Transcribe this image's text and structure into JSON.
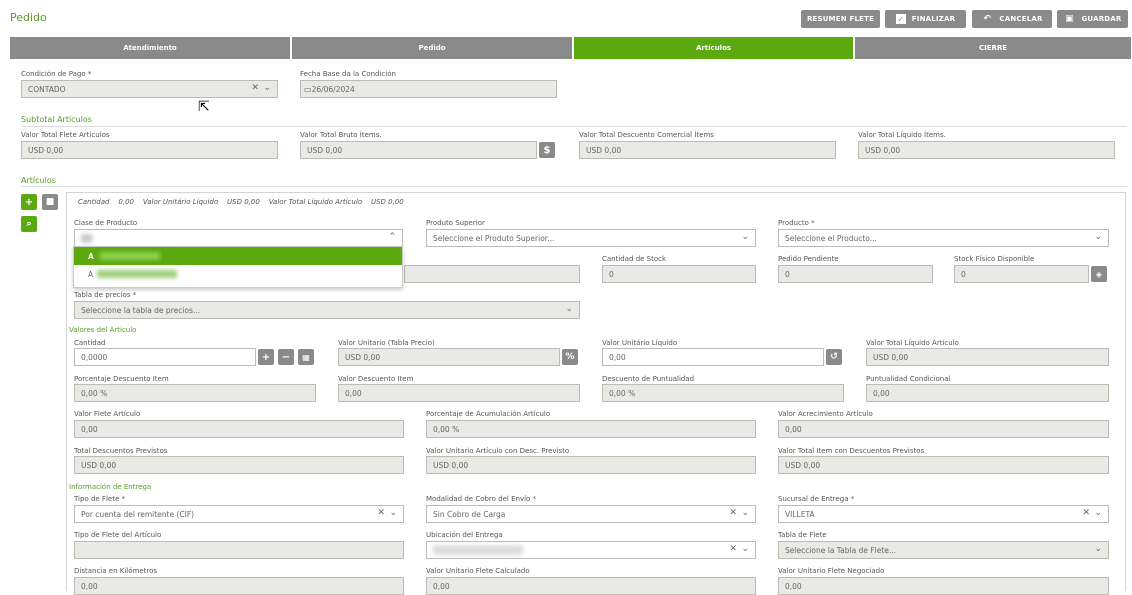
{
  "page": {
    "title": "Pedido"
  },
  "toolbar": {
    "resumen": "RESUMEN FLETE",
    "finalizar": "FINALIZAR",
    "cancelar": "CANCELAR",
    "guardar": "GUARDAR"
  },
  "tabs": [
    "Atendimiento",
    "Pedido",
    "Artículos",
    "CIERRE"
  ],
  "cond": {
    "label": "Condición de Pago *",
    "value": "CONTADO"
  },
  "fecha": {
    "label": "Fecha Base da la Condición",
    "value": "26/06/2024"
  },
  "subtotal": {
    "heading": "Subtotal Artículos",
    "flete": {
      "label": "Valor Total Flete Artículos",
      "value": "USD 0,00"
    },
    "bruto": {
      "label": "Valor Total Bruto Ítems.",
      "value": "USD 0,00"
    },
    "descuento": {
      "label": "Valor Total Descuento Comercial Ítems",
      "value": "USD 0,00"
    },
    "liquido": {
      "label": "Valor Total Líquido Ítems.",
      "value": "USD 0,00"
    }
  },
  "articulos": {
    "heading": "Artículos"
  },
  "summary": {
    "cantidad_label": "Cantidad",
    "cantidad": "0,00",
    "vul_label": "Valor Unitário Líquido",
    "vul": "USD 0,00",
    "vtl_label": "Valor Total Líquido Artículo",
    "vtl": "USD 0,00"
  },
  "clase": {
    "label": "Clase de Producto",
    "dropdown": [
      "A",
      "A"
    ]
  },
  "superior": {
    "label": "Produto Superior",
    "placeholder": "Seleccione el Produto Superior..."
  },
  "producto": {
    "label": "Producto *",
    "placeholder": "Seleccione el Producto..."
  },
  "stock": {
    "label": "Cantidad de Stock",
    "value": "0"
  },
  "pendiente": {
    "label": "Pedido Pendiente",
    "value": "0"
  },
  "fisico": {
    "label": "Stock Físico Disponible",
    "value": "0"
  },
  "tabla": {
    "label": "Tabla de precios *",
    "placeholder": "Seleccione la tabla de precios..."
  },
  "valores": {
    "heading": "Valores del Artículo",
    "cantidad": {
      "label": "Cantidad",
      "value": "0,0000"
    },
    "vutp": {
      "label": "Valor Unitario (Tabla Precio)",
      "value": "USD 0,00"
    },
    "vul": {
      "label": "Valor Unitário Líquido",
      "value": "0,00"
    },
    "vtla": {
      "label": "Valor Total Líquido Artículo",
      "value": "USD 0,00"
    },
    "pdi": {
      "label": "Porcentaje Descuento Item",
      "value": "0,00 %"
    },
    "vdi": {
      "label": "Valor Descuento Item",
      "value": "0,00"
    },
    "dp": {
      "label": "Descuento de Puntualidad",
      "value": "0,00 %"
    },
    "pc": {
      "label": "Puntualidad Condicional",
      "value": "0,00"
    },
    "vfa": {
      "label": "Valor Flete Artículo",
      "value": "0,00"
    },
    "paa": {
      "label": "Porcentaje de Acumulación Artículo",
      "value": "0,00 %"
    },
    "vaa": {
      "label": "Valor Acrecimiento Artículo",
      "value": "0,00"
    },
    "tdp": {
      "label": "Total Descuentos Previstos",
      "value": "USD 0,00"
    },
    "vuadp": {
      "label": "Valor Unitario Artículo con Desc. Previsto",
      "value": "USD 0,00"
    },
    "vtidp": {
      "label": "Valor Total Item con Descuentos Previstos",
      "value": "USD 0,00"
    }
  },
  "entrega": {
    "heading": "Información de Entrega",
    "tipo": {
      "label": "Tipo de Flete *",
      "value": "Por cuenta del remitente (CIF)"
    },
    "modalidad": {
      "label": "Modalidad de Cobro del Envío *",
      "value": "Sin Cobro de Carga"
    },
    "sucursal": {
      "label": "Sucursal de Entrega *",
      "value": "VILLETA"
    },
    "tfa": {
      "label": "Tipo de Flete del Artículo",
      "value": ""
    },
    "ubicacion": {
      "label": "Ubicación del Entrega",
      "value": ""
    },
    "tablaf": {
      "label": "Tabla de Flete",
      "placeholder": "Seleccione la Tabla de Flete..."
    },
    "dist": {
      "label": "Distancia en Kilómetros",
      "value": "0,00"
    },
    "vufc": {
      "label": "Valor Unitario Flete Calculado",
      "value": "0,00"
    },
    "vufn": {
      "label": "Valor Unitario Flete Negociado",
      "value": "0,00"
    }
  }
}
